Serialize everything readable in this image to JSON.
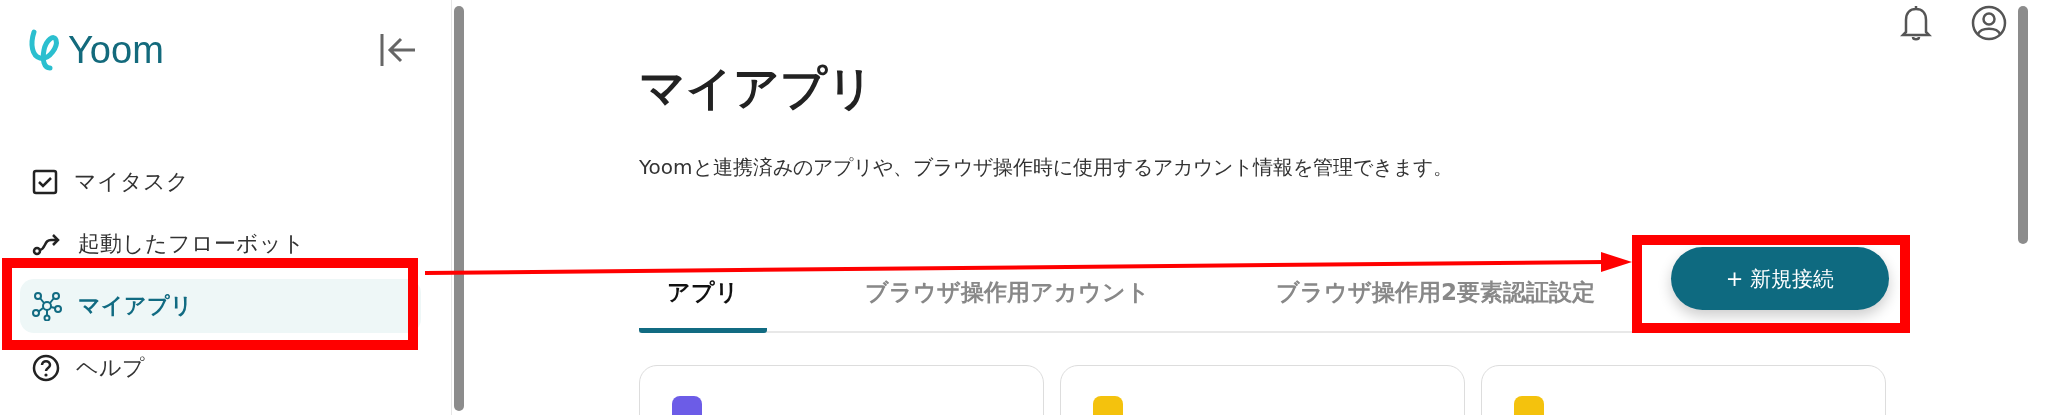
{
  "sidebar": {
    "logo": "Yoom",
    "items": [
      {
        "kind": "task",
        "label": "マイタスク",
        "selected": false
      },
      {
        "kind": "flow",
        "label": "起動したフローボット",
        "selected": false
      },
      {
        "kind": "apps",
        "label": "マイアプリ",
        "selected": true
      },
      {
        "kind": "help",
        "label": "ヘルプ",
        "selected": false
      }
    ]
  },
  "page": {
    "title": "マイアプリ",
    "description": "Yoomと連携済みのアプリや、ブラウザ操作時に使用するアカウント情報を管理できます。"
  },
  "tabs": [
    {
      "label": "アプリ",
      "selected": true
    },
    {
      "label": "ブラウザ操作用アカウント",
      "selected": false
    },
    {
      "label": "ブラウザ操作用2要素認証設定",
      "selected": false
    }
  ],
  "new_button": "+ 新規接続",
  "cards": [
    {
      "color": "#6c5ce7"
    },
    {
      "color": "#f4c20d"
    },
    {
      "color": "#f4c20d"
    }
  ]
}
